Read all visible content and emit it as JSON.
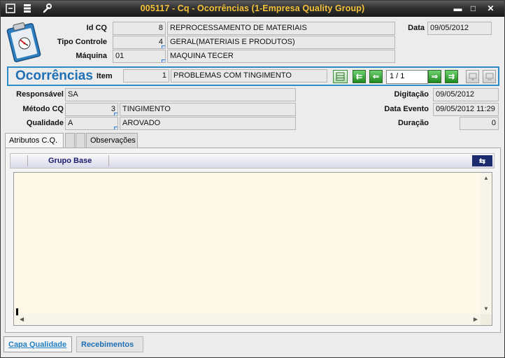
{
  "window": {
    "title": "005117 - Cq - Ocorrências (1-Empresa Quality Group)",
    "controls": {
      "minimize": "▬",
      "maximize": "□",
      "close": "✕"
    }
  },
  "header": {
    "id_cq": {
      "label": "Id CQ",
      "code": "8",
      "desc": "REPROCESSAMENTO DE MATERIAIS"
    },
    "data": {
      "label": "Data",
      "value": "09/05/2012"
    },
    "tipo_controle": {
      "label": "Tipo Controle",
      "code": "4",
      "desc": "GERAL(MATERIAIS E PRODUTOS)"
    },
    "maquina": {
      "label": "Máquina",
      "code": "01",
      "desc": "MAQUINA TECER"
    }
  },
  "ocorrencias": {
    "title": "Ocorrências",
    "item_label": "Item",
    "item_code": "1",
    "item_desc": "PROBLEMAS COM TINGIMENTO",
    "pager": "1 / 1",
    "nav": {
      "first": "⇇",
      "prev": "⇐",
      "next": "⇒",
      "last": "⇉"
    }
  },
  "details": {
    "responsavel": {
      "label": "Responsável",
      "value": "SA"
    },
    "metodo_cq": {
      "label": "Método CQ",
      "code": "3",
      "desc": "TINGIMENTO"
    },
    "qualidade": {
      "label": "Qualidade",
      "code": "A",
      "desc": "AROVADO"
    },
    "digitacao": {
      "label": "Digitação",
      "value": "09/05/2012"
    },
    "data_evento": {
      "label": "Data Evento",
      "value": "09/05/2012 11:29"
    },
    "duracao": {
      "label": "Duração",
      "value": "0"
    }
  },
  "tabs": [
    {
      "label": "Atributos C.Q.",
      "active": true
    },
    {
      "label": "",
      "active": false
    },
    {
      "label": "",
      "active": false
    },
    {
      "label": "Observações",
      "active": false
    }
  ],
  "grid": {
    "column": "Grupo Base",
    "arrows": "⇆"
  },
  "bottom_tabs": [
    {
      "label": "Capa Qualidade",
      "active": true
    },
    {
      "label": "Recebimentos",
      "active": false
    }
  ]
}
